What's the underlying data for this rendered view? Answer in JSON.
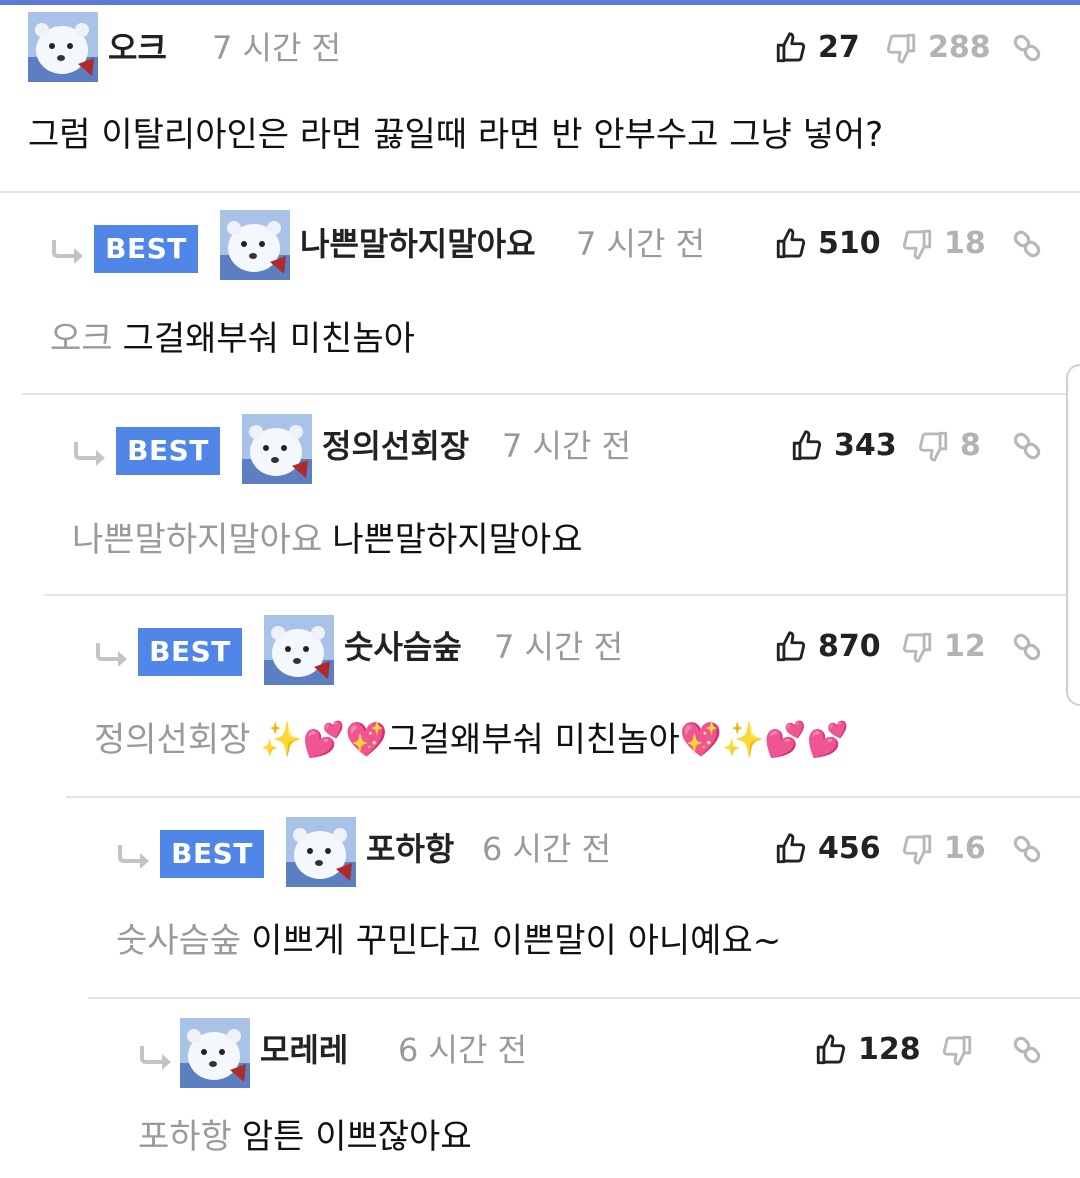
{
  "colors": {
    "accent": "#4f86e8",
    "top_bar": "#5b79d6"
  },
  "best_label": "BEST",
  "icons": {
    "like": "thumbs-up-icon",
    "dislike": "thumbs-down-icon",
    "link": "link-icon",
    "reply": "reply-arrow-icon",
    "avatar": "polar-bear-avatar"
  },
  "comments": [
    {
      "nick": "오크",
      "time": "7 시간 전",
      "likes": "27",
      "dislikes": "288",
      "best": false,
      "mention": "",
      "text": "그럼 이탈리아인은 라면 끓일때 라면 반 안부수고 그냥 넣어?",
      "emoji_before": "",
      "emoji_after": ""
    },
    {
      "nick": "나쁜말하지말아요",
      "time": "7 시간 전",
      "likes": "510",
      "dislikes": "18",
      "best": true,
      "mention": "오크",
      "text": "그걸왜부숴 미친놈아",
      "emoji_before": "",
      "emoji_after": ""
    },
    {
      "nick": "정의선회장",
      "time": "7 시간 전",
      "likes": "343",
      "dislikes": "8",
      "best": true,
      "mention": "나쁜말하지말아요",
      "text": "나쁜말하지말아요",
      "emoji_before": "",
      "emoji_after": ""
    },
    {
      "nick": "숫사슴숲",
      "time": "7 시간 전",
      "likes": "870",
      "dislikes": "12",
      "best": true,
      "mention": "정의선회장",
      "text": "그걸왜부숴 미친놈아",
      "emoji_before": "✨💕💖",
      "emoji_after": "💖✨💕💕"
    },
    {
      "nick": "포하항",
      "time": "6 시간 전",
      "likes": "456",
      "dislikes": "16",
      "best": true,
      "mention": "숫사슴숲",
      "text": "이쁘게 꾸민다고 이쁜말이 아니예요~",
      "emoji_before": "",
      "emoji_after": ""
    },
    {
      "nick": "모레레",
      "time": "6 시간 전",
      "likes": "128",
      "dislikes": "",
      "best": false,
      "mention": "포하항",
      "text": "암튼 이쁘잖아요",
      "emoji_before": "",
      "emoji_after": ""
    }
  ]
}
